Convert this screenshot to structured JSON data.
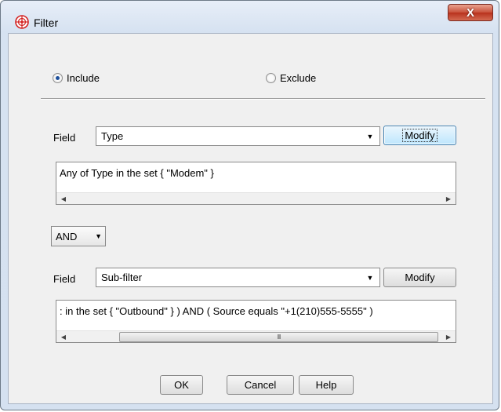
{
  "window": {
    "title": "Filter",
    "close_label": "X",
    "icon": "red-network-globe-icon"
  },
  "mode": {
    "include_label": "Include",
    "exclude_label": "Exclude",
    "selected": "include"
  },
  "filter1": {
    "field_label": "Field",
    "field_value": "Type",
    "modify_label": "Modify",
    "expression": "Any of Type in the set { \"Modem\" }"
  },
  "operator": {
    "value": "AND"
  },
  "filter2": {
    "field_label": "Field",
    "field_value": "Sub-filter",
    "modify_label": "Modify",
    "expression": ": in the set { \"Outbound\" } ) AND ( Source equals \"+1(210)555-5555\" )"
  },
  "buttons": {
    "ok": "OK",
    "cancel": "Cancel",
    "help": "Help"
  },
  "colors": {
    "accent": "#1d4f9b",
    "close_button": "#c8503a",
    "icon_red": "#d32121"
  }
}
